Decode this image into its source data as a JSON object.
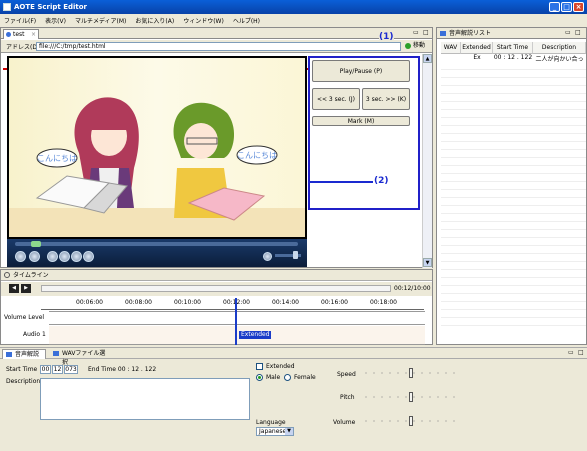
{
  "window": {
    "title": "AOTE Script Editor",
    "min": "_",
    "max": "□",
    "close": "×"
  },
  "menu": [
    "ファイル(F)",
    "表示(V)",
    "マルチメディア(M)",
    "お気に入り(A)",
    "ウィンドウ(W)",
    "ヘルプ(H)"
  ],
  "editor": {
    "tab_label": "test",
    "address_label": "アドレス(D)",
    "address_value": "file:///C:/tmp/test.html",
    "go_label": "移動"
  },
  "controls": {
    "play_pause": "Play/Pause (P)",
    "back": "<< 3 sec. (J)",
    "forward": "3 sec. >> (K)",
    "mark": "Mark (M)"
  },
  "annotations": {
    "a1": "(1)",
    "a2": "(2)"
  },
  "scene": {
    "bubble_left": "こんにちは",
    "bubble_right": "こんにちは"
  },
  "timeline": {
    "header": "タイムライン",
    "time_display": "00:12/10:00",
    "ticks": [
      "00:06:00",
      "00:08:00",
      "00:10:00",
      "00:12:00",
      "00:14:00",
      "00:16:00",
      "00:18:00"
    ],
    "track_volume": "Volume Level",
    "track_audio": "Audio 1",
    "block_label": "Extended"
  },
  "list": {
    "title": "音声解説リスト",
    "columns": [
      "WAV",
      "Extended",
      "Start Time",
      "Description"
    ],
    "rows": [
      {
        "wav": "",
        "extended": "Ex",
        "start": "00 : 12 . 122",
        "desc": "二人が向かい合っ"
      }
    ]
  },
  "bottom": {
    "tab1": "音声解説",
    "tab2": "WAVファイル選択",
    "start_time_label": "Start Time",
    "start_hh": "00",
    "start_mm": "12",
    "start_ms": "073",
    "end_time_text": "End Time  00 : 12 . 122",
    "description_label": "Description",
    "extended_label": "Extended",
    "male_label": "Male",
    "female_label": "Female",
    "language_label": "Language",
    "language_value": "Japanese",
    "speed_label": "Speed",
    "pitch_label": "Pitch",
    "volume_label": "Volume",
    "speed_level": 0.5,
    "pitch_level": 0.5,
    "volume_level": 0.5
  }
}
